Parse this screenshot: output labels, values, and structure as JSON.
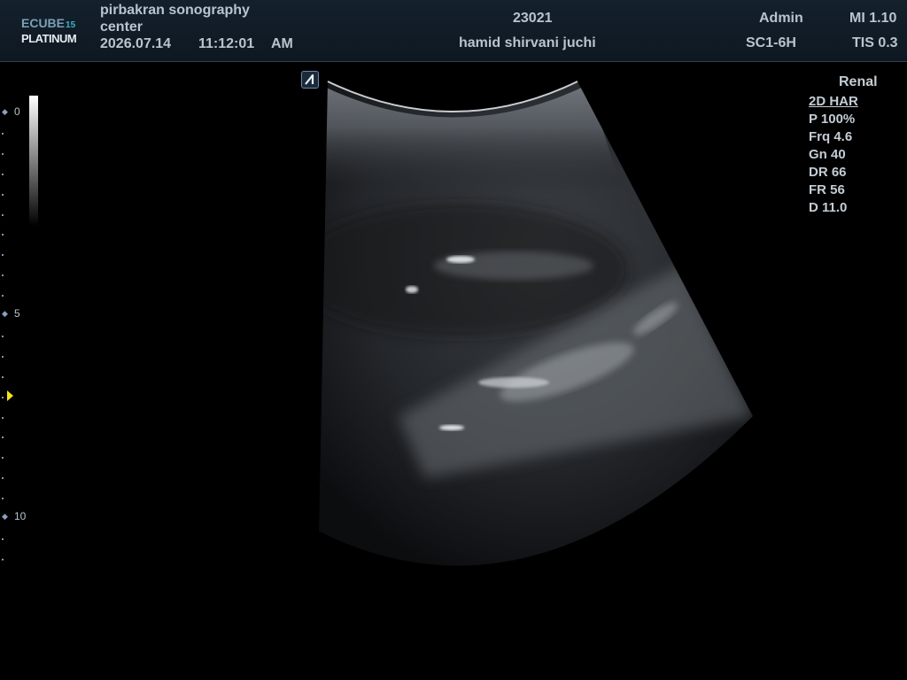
{
  "header": {
    "logo": {
      "brand": "ECUBE",
      "model_number": "15",
      "edition": "PLATINUM"
    },
    "institution_line1": "pirbakran sonography",
    "institution_line2": "center",
    "date": "2026.07.14",
    "time": "11:12:01",
    "ampm": "AM",
    "patient_id": "23021",
    "patient_name": "hamid shirvani juchi",
    "operator": "Admin",
    "probe": "SC1-6H",
    "mi": "MI 1.10",
    "tis": "TIS 0.3"
  },
  "depth_scale": {
    "labels": [
      "0",
      "5",
      "10"
    ]
  },
  "orientation_badge": {
    "letter": "A"
  },
  "params": {
    "preset": "Renal",
    "mode": "2D HAR",
    "power": "P 100%",
    "frequency": "Frq 4.6",
    "gain": "Gn 40",
    "dynamic_range": "DR 66",
    "frame_rate": "FR 56",
    "depth": "D 11.0"
  },
  "colors": {
    "header_bg": "#14202c",
    "header_text": "#b9c4cf",
    "accent_teal": "#39b5c4",
    "focus_marker": "#f2e51a",
    "scale_marks": "#7d93b8"
  }
}
